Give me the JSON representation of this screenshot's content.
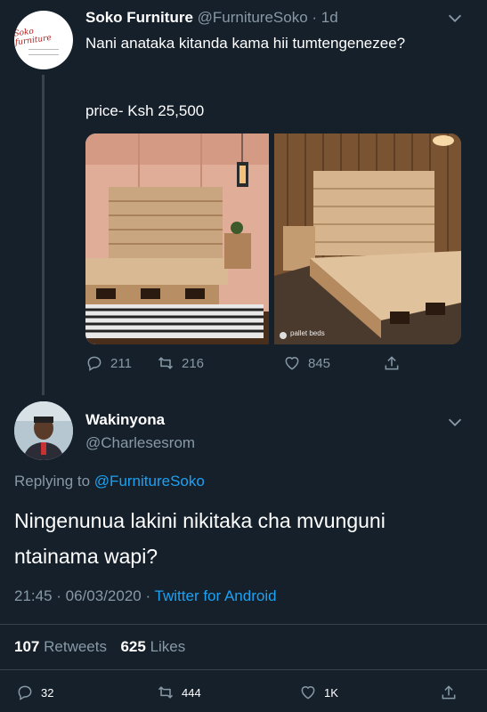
{
  "tweet": {
    "author_name": "Soko Furniture",
    "author_handle": "@FurnitureSoko",
    "time": "· 1d",
    "text": "Nani anataka kitanda kama hii tumtengenezee?",
    "price_line": "price- Ksh 25,500",
    "logo_text": "Soko furniture",
    "watermark": "pallet beds",
    "actions": {
      "replies": "211",
      "retweets": "216",
      "likes": "845"
    }
  },
  "reply": {
    "author_name": "Wakinyona",
    "author_handle": "@Charlesesrom",
    "replying_label": "Replying to",
    "replying_to": "@FurnitureSoko",
    "text": "Ningenunua lakini nikitaka cha mvunguni ntainama wapi?",
    "time": "21:45 · 06/03/2020 ·",
    "client": "Twitter for Android",
    "retweet_count": "107",
    "retweet_label": "Retweets",
    "like_count": "625",
    "like_label": "Likes",
    "actions": {
      "replies": "32",
      "retweets": "444",
      "likes": "1K"
    }
  },
  "colors": {
    "background": "#15202b",
    "muted": "#8899a6",
    "link": "#1da1f2",
    "divider": "#38444d"
  },
  "icons": [
    "reply-icon",
    "retweet-icon",
    "like-icon",
    "share-icon",
    "chevron-down-icon"
  ]
}
